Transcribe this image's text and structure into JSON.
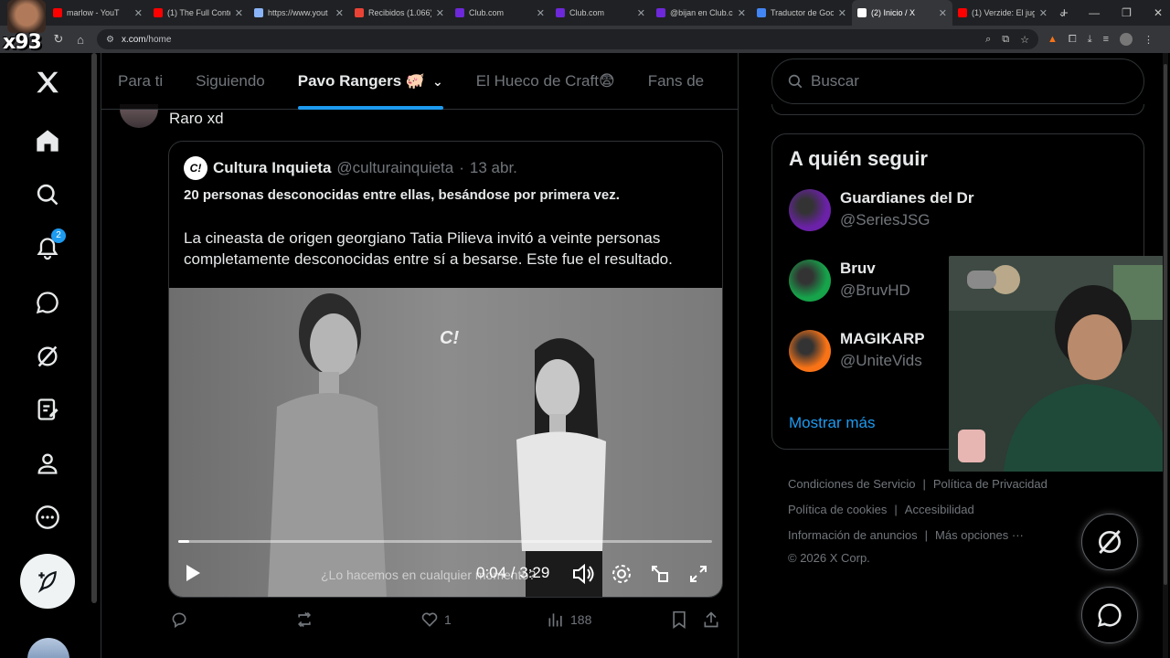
{
  "browser": {
    "tabs": [
      {
        "title": "marlow - YouT",
        "color": "#ff0000"
      },
      {
        "title": "(1) The Full Conte",
        "color": "#ff0000"
      },
      {
        "title": "https://www.yout",
        "color": "#8ab4f8"
      },
      {
        "title": "Recibidos (1.066)",
        "color": "#ea4335"
      },
      {
        "title": "Club.com",
        "color": "#6d28d9"
      },
      {
        "title": "Club.com",
        "color": "#6d28d9"
      },
      {
        "title": "@bijan en Club.c",
        "color": "#6d28d9"
      },
      {
        "title": "Traductor de Goo",
        "color": "#4285f4"
      },
      {
        "title": "(2) Inicio / X",
        "color": "#ffffff",
        "active": true
      },
      {
        "title": "(1) Verzide: El jug",
        "color": "#ff0000"
      }
    ],
    "url_prefix": "x.com",
    "url_path": "/home"
  },
  "overlay": {
    "streamer_tag": "x93"
  },
  "sidenav": {
    "notifications_count": "2"
  },
  "timeline": {
    "tabs": [
      {
        "label": "Para ti"
      },
      {
        "label": "Siguiendo"
      },
      {
        "label": "Pavo Rangers 🐖",
        "active": true
      },
      {
        "label": "El Hueco de Craft😨"
      },
      {
        "label": "Fans de"
      }
    ],
    "tweet": {
      "text": "Raro xd",
      "quote": {
        "logo": "C!",
        "name": "Cultura Inquieta",
        "handle": "@culturainquieta",
        "dot": "·",
        "date": "13 abr.",
        "headline": "20 personas desconocidas entre ellas, besándose por primera vez.",
        "body": "La cineasta de origen georgiano Tatia Pilieva invitó a veinte personas completamente desconocidas entre sí a besarse. Este fue el resultado.",
        "video": {
          "watermark": "C!",
          "subtitle": "¿Lo hacemos en cualquier momento?",
          "time": "0:04 / 3:29",
          "progress": 0.02
        }
      },
      "likes": "1",
      "views": "188"
    }
  },
  "right": {
    "search_placeholder": "Buscar",
    "who_to_follow": {
      "title": "A quién seguir",
      "accounts": [
        {
          "name": "Guardianes del Dr",
          "handle": "@SeriesJSG",
          "color": "#6b21a8"
        },
        {
          "name": "Bruv",
          "handle": "@BruvHD",
          "color": "#16a34a"
        },
        {
          "name": "MAGIKARP",
          "handle": "@UniteVids",
          "color": "#f97316"
        }
      ],
      "show_more": "Mostrar más"
    },
    "footer": {
      "links": [
        "Condiciones de Servicio",
        "Política de Privacidad",
        "Política de cookies",
        "Accesibilidad",
        "Información de anuncios",
        "Más opciones ···"
      ],
      "copyright": "© 2026 X Corp."
    }
  }
}
